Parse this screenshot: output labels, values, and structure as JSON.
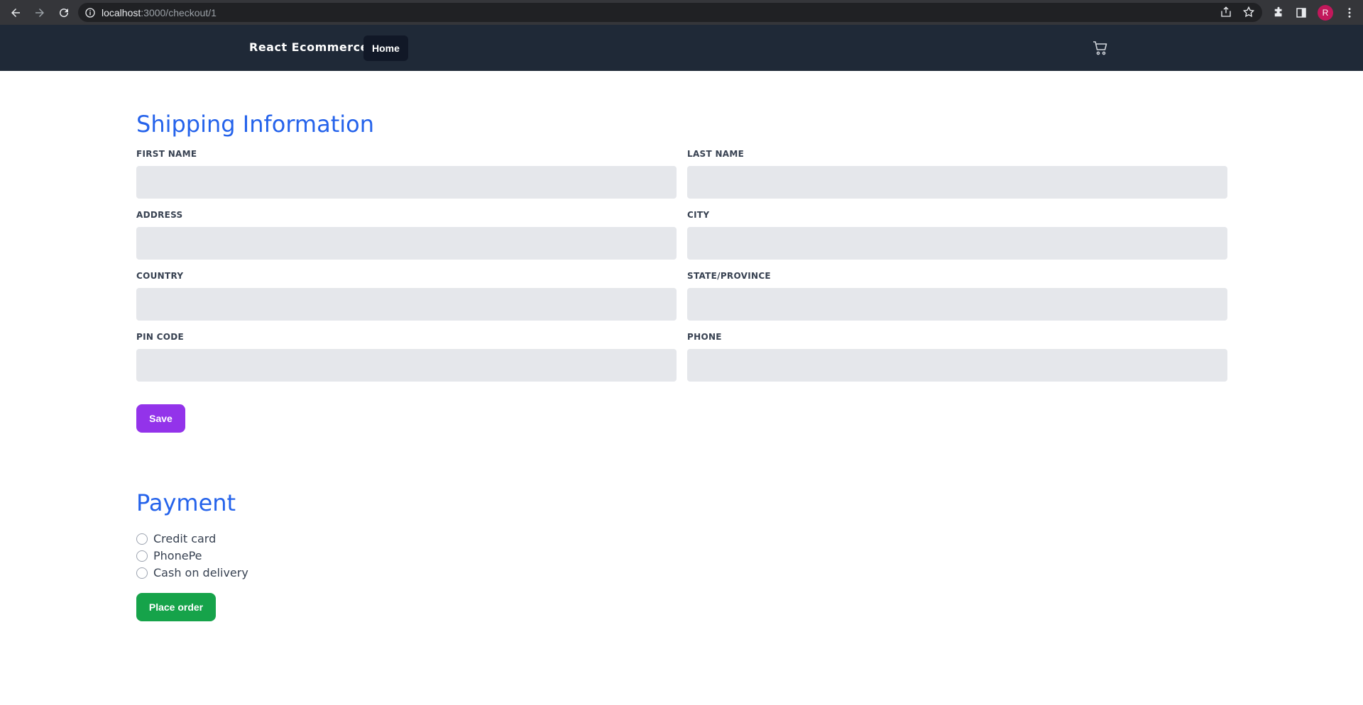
{
  "browser": {
    "url_host": "localhost",
    "url_path": ":3000/checkout/1",
    "profile_initial": "R"
  },
  "navbar": {
    "brand": "React Ecommerce",
    "home_label": "Home"
  },
  "shipping": {
    "title": "Shipping Information",
    "fields": {
      "first_name": "FIRST NAME",
      "last_name": "LAST NAME",
      "address": "ADDRESS",
      "city": "CITY",
      "country": "COUNTRY",
      "state": "STATE/PROVINCE",
      "pin_code": "PIN CODE",
      "phone": "PHONE"
    },
    "values": {
      "first_name": "",
      "last_name": "",
      "address": "",
      "city": "",
      "country": "",
      "state": "",
      "pin_code": "",
      "phone": ""
    },
    "save_label": "Save"
  },
  "payment": {
    "title": "Payment",
    "options": [
      "Credit card",
      "PhonePe",
      "Cash on delivery"
    ],
    "place_order_label": "Place order"
  },
  "colors": {
    "navbar_bg": "#1f2937",
    "title_blue": "#2563eb",
    "save_purple": "#9333ea",
    "place_order_green": "#16a34a",
    "input_bg": "#e5e7eb"
  },
  "icons": {
    "back": "arrow-left-icon",
    "forward": "arrow-right-icon",
    "reload": "reload-icon",
    "info": "info-icon",
    "share": "share-icon",
    "bookmark": "star-icon",
    "extensions": "puzzle-icon",
    "sidepanel": "side-panel-icon",
    "menu": "kebab-menu-icon",
    "cart": "cart-icon"
  }
}
